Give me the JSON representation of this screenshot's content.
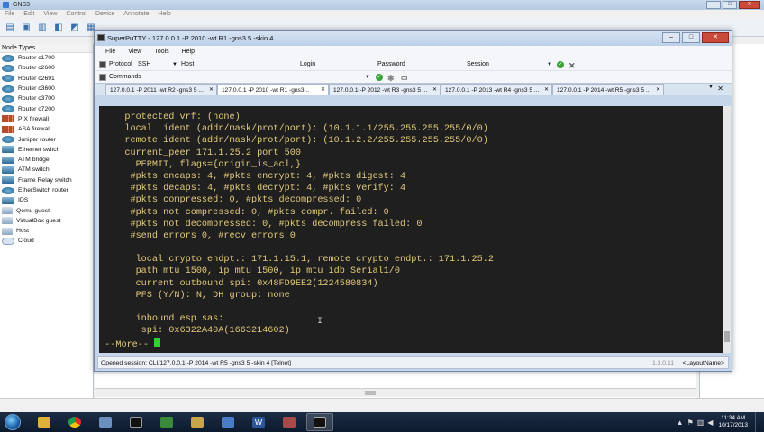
{
  "gns3": {
    "title": "GNS3",
    "menu": [
      "File",
      "Edit",
      "View",
      "Control",
      "Device",
      "Annotate",
      "Help"
    ],
    "node_panel_title": "Node Types",
    "nodes": [
      "Router c1700",
      "Router c2600",
      "Router c2691",
      "Router c3600",
      "Router c3700",
      "Router c7200",
      "PIX firewall",
      "ASA firewall",
      "Juniper router",
      "Ethernet switch",
      "ATM bridge",
      "ATM switch",
      "Frame Relay switch",
      "EtherSwitch router",
      "IDS",
      "Qemu guest",
      "VirtualBox guest",
      "Host",
      "Cloud"
    ]
  },
  "putty": {
    "title": "SuperPuTTY - 127.0.0.1 -P 2010 -wt R1 -gns3 5 -skin 4",
    "menu": [
      "File",
      "View",
      "Tools",
      "Help"
    ],
    "conn": {
      "protocol_label": "Protocol",
      "protocol_value": "SSH",
      "host_label": "Host",
      "login_label": "Login",
      "password_label": "Password",
      "session_label": "Session"
    },
    "commands_label": "Commands",
    "tabs": [
      "127.0.0.1 -P 2011 -wt R2 -gns3 5 ...",
      "127.0.0.1 -P 2010 -wt R1 -gns3...",
      "127.0.0.1 -P 2012 -wt R3 -gns3 5 ...",
      "127.0.0.1 -P 2013 -wt R4 -gns3 5 ...",
      "127.0.0.1 -P 2014 -wt R5 -gns3 5 ..."
    ],
    "terminal_lines": [
      "   protected vrf: (none)",
      "   local  ident (addr/mask/prot/port): (10.1.1.1/255.255.255.255/0/0)",
      "   remote ident (addr/mask/prot/port): (10.1.2.2/255.255.255.255/0/0)",
      "   current_peer 171.1.25.2 port 500",
      "     PERMIT, flags={origin_is_acl,}",
      "    #pkts encaps: 4, #pkts encrypt: 4, #pkts digest: 4",
      "    #pkts decaps: 4, #pkts decrypt: 4, #pkts verify: 4",
      "    #pkts compressed: 0, #pkts decompressed: 0",
      "    #pkts not compressed: 0, #pkts compr. failed: 0",
      "    #pkts not decompressed: 0, #pkts decompress failed: 0",
      "    #send errors 0, #recv errors 0",
      "",
      "     local crypto endpt.: 171.1.15.1, remote crypto endpt.: 171.1.25.2",
      "     path mtu 1500, ip mtu 1500, ip mtu idb Serial1/0",
      "     current outbound spi: 0x48FD9EE2(1224580834)",
      "     PFS (Y/N): N, DH group: none",
      "",
      "     inbound esp sas:",
      "      spi: 0x6322A40A(1663214602)"
    ],
    "more_prompt": " --More-- ",
    "status_text": "Opened session: CLI/127.0.0.1 -P 2014 -wt R5 -gns3 5 -skin 4 [Telnet]",
    "version": "1.3.0.11",
    "layout_label": "<LayoutName>"
  },
  "taskbar": {
    "time": "11:34 AM",
    "date": "10/17/2013"
  }
}
